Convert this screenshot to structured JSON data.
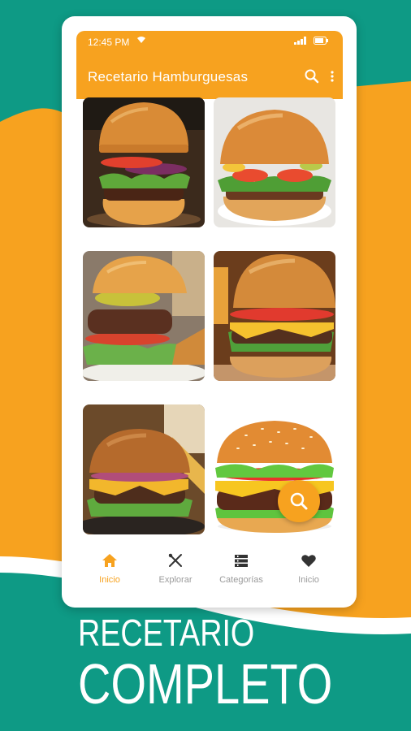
{
  "colors": {
    "teal": "#0e9a85",
    "orange": "#f7a21f",
    "white": "#ffffff",
    "nav_inactive": "#9b9b9b"
  },
  "status_bar": {
    "time": "12:45 PM",
    "icons": [
      "wifi-icon",
      "signal-icon",
      "battery-icon"
    ]
  },
  "app_bar": {
    "title": "Recetario Hamburguesas",
    "icons": [
      "search-icon",
      "more-vert-icon"
    ]
  },
  "gallery": {
    "items": [
      {
        "image": "burger-photo-1"
      },
      {
        "image": "burger-photo-2"
      },
      {
        "image": "burger-photo-3"
      },
      {
        "image": "burger-photo-4"
      },
      {
        "image": "burger-photo-5"
      },
      {
        "image": "burger-photo-6"
      }
    ]
  },
  "fab": {
    "icon": "search-icon"
  },
  "bottom_nav": {
    "items": [
      {
        "label": "Inicio",
        "icon": "home-icon",
        "active": true
      },
      {
        "label": "Explorar",
        "icon": "utensils-icon",
        "active": false
      },
      {
        "label": "Categorías",
        "icon": "list-icon",
        "active": false
      },
      {
        "label": "Inicio",
        "icon": "heart-icon",
        "active": false
      }
    ]
  },
  "promo": {
    "line1": "RECETARIO",
    "line2": "COMPLETO"
  }
}
